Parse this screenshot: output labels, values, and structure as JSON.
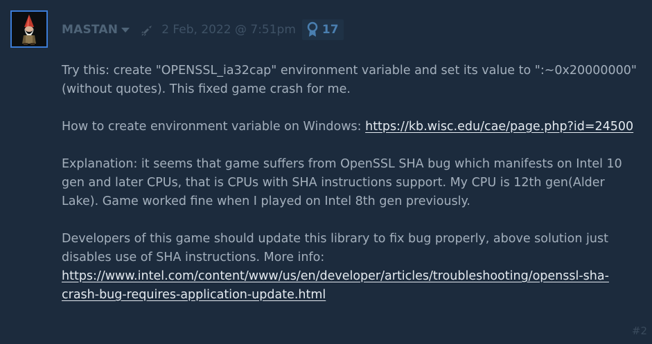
{
  "post": {
    "author": "MASTAN",
    "date": "2 Feb, 2022 @ 7:51pm",
    "award_count": "17",
    "post_number": "#2",
    "icons": {
      "avatar": "gnome-avatar",
      "author_menu": "chevron-down-icon",
      "award_badge": "rocket-icon",
      "award": "award-ribbon-icon"
    },
    "colors": {
      "background": "#1c2b3d",
      "avatar_border": "#3c7cd6",
      "text": "#a4b0bd",
      "link": "#e4eaf0",
      "award": "#4a7fb0"
    },
    "paragraphs": {
      "p1": "Try this: create \"OPENSSL_ia32cap\" environment variable and set its value to \":~0x20000000\" (without quotes). This fixed game crash for me.",
      "p2_text": "How to create environment variable on Windows: ",
      "p2_link": "https://kb.wisc.edu/cae/page.php?id=24500",
      "p3": "Explanation: it seems that game suffers from OpenSSL SHA bug which manifests on Intel 10 gen and later CPUs, that is CPUs with SHA instructions support. My CPU is 12th gen(Alder Lake). Game worked fine when I played on Intel 8th gen previously.",
      "p4_text": "Developers of this game should update this library to fix bug properly, above solution just disables use of SHA instructions. More info: ",
      "p4_link": "https://www.intel.com/content/www/us/en/developer/articles/troubleshooting/openssl-sha-crash-bug-requires-application-update.html"
    }
  }
}
